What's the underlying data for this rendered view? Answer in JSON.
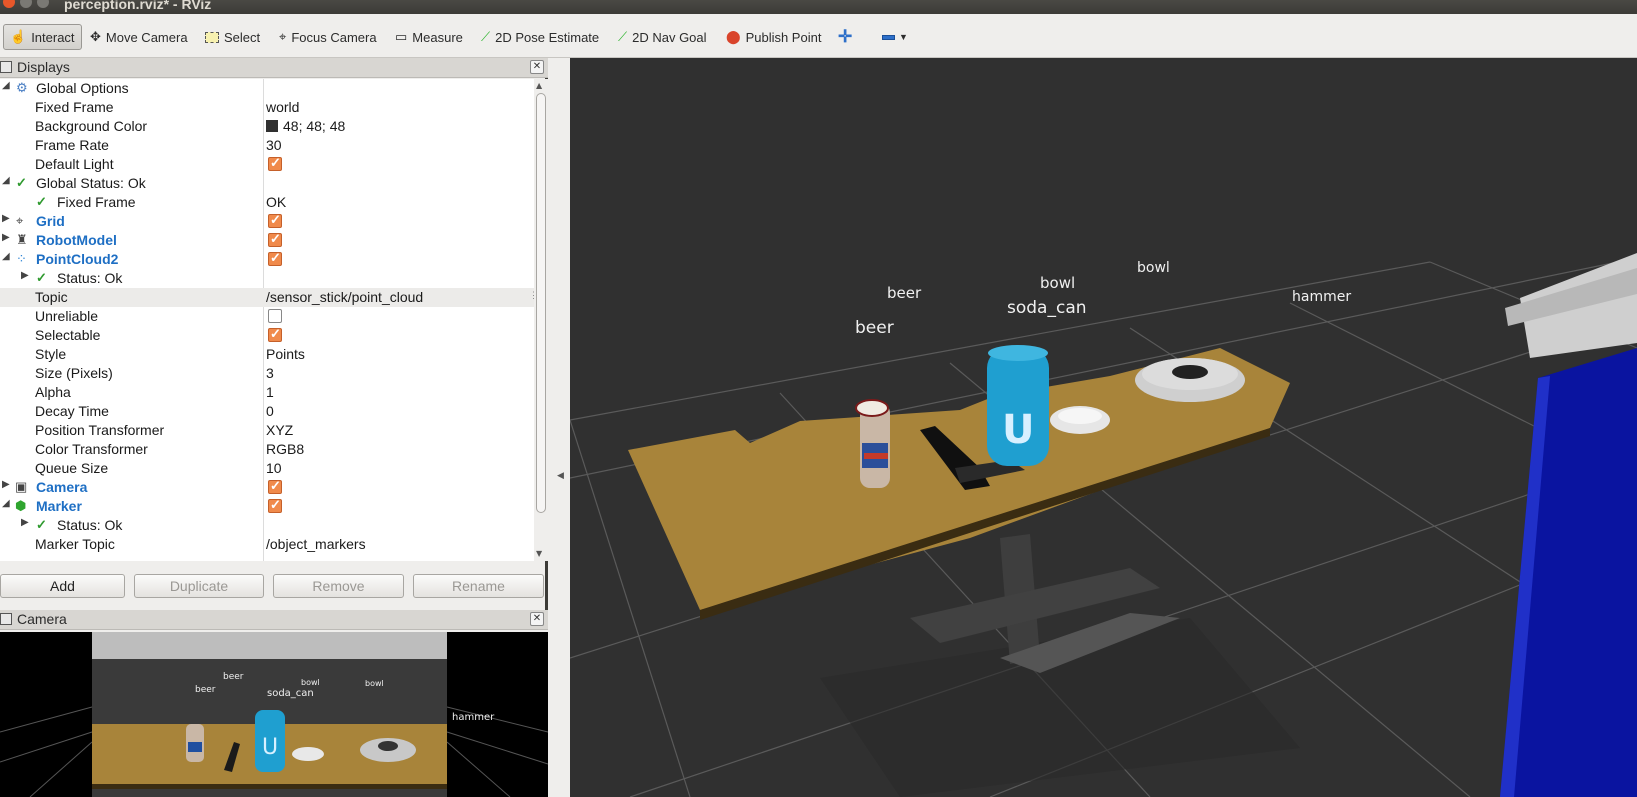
{
  "window": {
    "title": "perception.rviz* - RViz"
  },
  "toolbar": {
    "interact": "Interact",
    "move_camera": "Move Camera",
    "select": "Select",
    "focus_camera": "Focus Camera",
    "measure": "Measure",
    "pose_estimate": "2D Pose Estimate",
    "nav_goal": "2D Nav Goal",
    "publish_point": "Publish Point"
  },
  "displays": {
    "title": "Displays",
    "rows": {
      "global_options": "Global Options",
      "fixed_frame": {
        "label": "Fixed Frame",
        "value": "world"
      },
      "background_color": {
        "label": "Background Color",
        "value": "48; 48; 48"
      },
      "frame_rate": {
        "label": "Frame Rate",
        "value": "30"
      },
      "default_light": {
        "label": "Default Light"
      },
      "global_status": "Global Status: Ok",
      "status_fixed_frame": {
        "label": "Fixed Frame",
        "value": "OK"
      },
      "grid": "Grid",
      "robot_model": "RobotModel",
      "pointcloud2": "PointCloud2",
      "pc_status": "Status: Ok",
      "topic": {
        "label": "Topic",
        "value": "/sensor_stick/point_cloud"
      },
      "unreliable": {
        "label": "Unreliable"
      },
      "selectable": {
        "label": "Selectable"
      },
      "style": {
        "label": "Style",
        "value": "Points"
      },
      "size_pixels": {
        "label": "Size (Pixels)",
        "value": "3"
      },
      "alpha": {
        "label": "Alpha",
        "value": "1"
      },
      "decay_time": {
        "label": "Decay Time",
        "value": "0"
      },
      "position_transformer": {
        "label": "Position Transformer",
        "value": "XYZ"
      },
      "color_transformer": {
        "label": "Color Transformer",
        "value": "RGB8"
      },
      "queue_size": {
        "label": "Queue Size",
        "value": "10"
      },
      "camera": "Camera",
      "marker": "Marker",
      "marker_status": "Status: Ok",
      "marker_topic": {
        "label": "Marker Topic",
        "value": "/object_markers"
      }
    },
    "checkbox_states": {
      "default_light": true,
      "grid": true,
      "robot_model": true,
      "pointcloud2": true,
      "unreliable": false,
      "selectable": true,
      "camera": true,
      "marker": true
    },
    "buttons": {
      "add": "Add",
      "duplicate": "Duplicate",
      "remove": "Remove",
      "rename": "Rename"
    }
  },
  "camera_panel": {
    "title": "Camera",
    "labels": {
      "beer1": "beer",
      "beer2": "beer",
      "soda_can": "soda_can",
      "bowl1": "bowl",
      "bowl2": "bowl",
      "hammer": "hammer"
    }
  },
  "scene": {
    "labels": {
      "beer1": "beer",
      "beer2": "beer",
      "bowl1": "bowl",
      "bowl2": "bowl",
      "soda_can": "soda_can",
      "hammer": "hammer"
    }
  },
  "colors": {
    "background": "#303030",
    "table": "#a8843a",
    "soda_can": "#1f9fd0",
    "robot_blue": "#0a14a0",
    "accent_orange": "#f08a4b",
    "link_blue": "#1e6fc4",
    "status_green": "#2f9a2f"
  },
  "icons": {
    "interact": "hand-pointer-icon",
    "move_camera": "move-arrows-icon",
    "select": "select-rectangle-icon",
    "focus_camera": "crosshair-icon",
    "measure": "ruler-icon",
    "pose_estimate": "green-arrow-icon",
    "nav_goal": "green-arrow-icon",
    "publish_point": "map-pin-icon",
    "add_tool": "plus-icon",
    "remove_tool": "minus-icon"
  }
}
